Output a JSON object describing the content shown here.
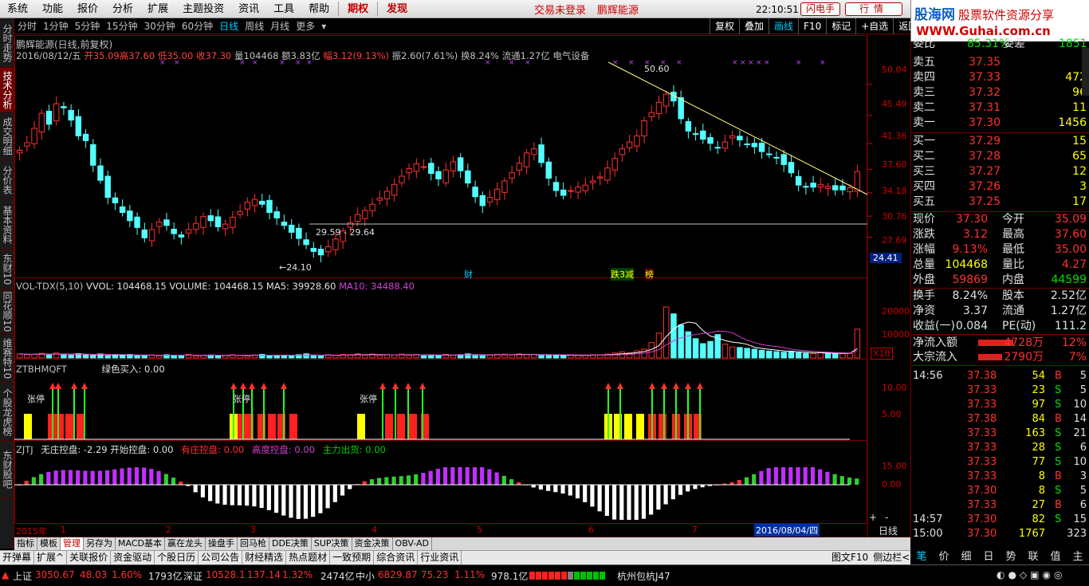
{
  "menu": {
    "items": [
      "系统",
      "功能",
      "报价",
      "分析",
      "扩展",
      "主题投资",
      "资讯",
      "工具",
      "帮助"
    ],
    "red_items": [
      "期权",
      "发现"
    ],
    "notice": "交易未登录",
    "stock_name": "鹏辉能源",
    "clock": "22:10:51 周五",
    "flash_trade": "闪电手",
    "quote_btn": "行情",
    "logo_line1": "股海网",
    "logo_line1b": "股票软件资源分享",
    "logo_line2": "WWW.Guhai.com.cn"
  },
  "periods": [
    "分时",
    "1分钟",
    "5分钟",
    "15分钟",
    "30分钟",
    "60分钟",
    "日线",
    "周线",
    "月线",
    "更多"
  ],
  "active_period": "日线",
  "chart_buttons": [
    "复权",
    "叠加",
    "画线",
    "F10",
    "标记",
    "+自选",
    "返回"
  ],
  "left_tabs": [
    "分时走势",
    "技术分析",
    "成交明细",
    "分价表",
    "基本资料",
    "东财10",
    "同花顺10",
    "维赛特10",
    "个股龙虎榜",
    "东财股吧"
  ],
  "header": {
    "title": "鹏辉能源(日线,前复权)",
    "date": "2016/08/12/五",
    "open": "开35.09",
    "high": "高37.60",
    "low": "低35.00",
    "close": "收37.30",
    "vol": "量104468",
    "amount": "额3.83亿",
    "change": "幅3.12(9.13%)",
    "amp": "振2.60(7.61%)",
    "turnover": "换8.24%",
    "float": "流通1.27亿",
    "sector": "电气设备"
  },
  "price_axis": [
    "50.04",
    "45.49",
    "41.36",
    "37.60",
    "34.18",
    "30.76",
    "27.69"
  ],
  "current_price_tag": "24.41",
  "annotations": {
    "peak": "50.60",
    "trough": "24.10",
    "range": "29.59 - 29.64",
    "cai": "财",
    "jian": "跌3减",
    "bang": "榜"
  },
  "vol_panel": {
    "label": "VOL-TDX(5,10)",
    "vvol": "VVOL: 104468.15",
    "volume": "VOLUME: 104468.15",
    "ma5": "MA5: 39928.60",
    "ma10": "MA10: 34488.40",
    "axis": [
      "20000",
      "10000"
    ],
    "unit": "X10"
  },
  "signal_panel": {
    "label": "ZTBHMQFT",
    "buy": "绿色买入: 0.00",
    "axis": [
      "10.00",
      "5.00"
    ],
    "tags": [
      "张停",
      "张停",
      "张停"
    ]
  },
  "ztj_panel": {
    "label": "ZJTJ",
    "a": "无庄控盘: -2.29",
    "b": "开始控盘: 0.00",
    "c": "有庄控盘: 0.00",
    "d": "高度控盘: 0.00",
    "e": "主力出货: 0.00",
    "axis": [
      "15.00",
      "0.00"
    ]
  },
  "x_axis": {
    "labels": [
      "2015年",
      "1",
      "2",
      "3",
      "4",
      "5",
      "6",
      "7"
    ],
    "cursor_date": "2016/08/04/四",
    "period": "日线"
  },
  "order_book": {
    "top": {
      "l": "委比",
      "v": "85.31%",
      "l2": "委差",
      "v2": "1851"
    },
    "asks": [
      {
        "label": "卖五",
        "price": "37.35",
        "vol": ""
      },
      {
        "label": "卖四",
        "price": "37.33",
        "vol": "472"
      },
      {
        "label": "卖三",
        "price": "37.32",
        "vol": "96"
      },
      {
        "label": "卖二",
        "price": "37.31",
        "vol": "11"
      },
      {
        "label": "卖一",
        "price": "37.30",
        "vol": "1456"
      }
    ],
    "bids": [
      {
        "label": "买一",
        "price": "37.29",
        "vol": "15"
      },
      {
        "label": "买二",
        "price": "37.28",
        "vol": "65"
      },
      {
        "label": "买三",
        "price": "37.27",
        "vol": "12"
      },
      {
        "label": "买四",
        "price": "37.26",
        "vol": "3"
      },
      {
        "label": "买五",
        "price": "37.25",
        "vol": "17"
      }
    ]
  },
  "stats": [
    {
      "l1": "现价",
      "v1": "37.30",
      "l2": "今开",
      "v2": "35.09",
      "c1": "r",
      "c2": "r"
    },
    {
      "l1": "涨跌",
      "v1": "3.12",
      "l2": "最高",
      "v2": "37.60",
      "c1": "r",
      "c2": "r"
    },
    {
      "l1": "涨幅",
      "v1": "9.13%",
      "l2": "最低",
      "v2": "35.00",
      "c1": "r",
      "c2": "r"
    },
    {
      "l1": "总量",
      "v1": "104468",
      "l2": "量比",
      "v2": "4.27",
      "c1": "y",
      "c2": "r"
    },
    {
      "l1": "外盘",
      "v1": "59869",
      "l2": "内盘",
      "v2": "44599",
      "c1": "r",
      "c2": "g"
    }
  ],
  "stats2": [
    {
      "l1": "换手",
      "v1": "8.24%",
      "l2": "股本",
      "v2": "2.52亿"
    },
    {
      "l1": "净资",
      "v1": "3.37",
      "l2": "流通",
      "v2": "1.27亿"
    },
    {
      "l1": "收益(一)",
      "v1": "0.084",
      "l2": "PE(动)",
      "v2": "111.2"
    }
  ],
  "flow": [
    {
      "l": "净流入额",
      "v": "4728万",
      "p": "12%"
    },
    {
      "l": "大宗流入",
      "v": "2790万",
      "p": "7%"
    }
  ],
  "ticks": [
    {
      "t": "14:56",
      "p": "37.38",
      "v": "54",
      "bs": "B",
      "n": "5"
    },
    {
      "t": "",
      "p": "37.33",
      "v": "23",
      "bs": "S",
      "n": "5"
    },
    {
      "t": "",
      "p": "37.33",
      "v": "97",
      "bs": "S",
      "n": "10"
    },
    {
      "t": "",
      "p": "37.38",
      "v": "84",
      "bs": "B",
      "n": "14"
    },
    {
      "t": "",
      "p": "37.33",
      "v": "163",
      "bs": "S",
      "n": "21"
    },
    {
      "t": "",
      "p": "37.33",
      "v": "28",
      "bs": "S",
      "n": "6"
    },
    {
      "t": "",
      "p": "37.33",
      "v": "77",
      "bs": "S",
      "n": "10"
    },
    {
      "t": "",
      "p": "37.33",
      "v": "8",
      "bs": "B",
      "n": "3"
    },
    {
      "t": "",
      "p": "37.30",
      "v": "8",
      "bs": "S",
      "n": "5"
    },
    {
      "t": "",
      "p": "37.33",
      "v": "27",
      "bs": "B",
      "n": "6"
    },
    {
      "t": "14:57",
      "p": "37.30",
      "v": "82",
      "bs": "S",
      "n": "15"
    },
    {
      "t": "15:00",
      "p": "37.30",
      "v": "1767",
      "bs": "",
      "n": "323"
    }
  ],
  "bottom_tabs1": [
    "指标",
    "模板",
    "管理",
    "另存为",
    "MACD基本",
    "赢在龙头",
    "操盘手",
    "回马枪",
    "DDE决策",
    "SUP决策",
    "资金决策",
    "OBV-AD"
  ],
  "bottom_tabs2": [
    "开弹幕",
    "扩展^",
    "关联报价",
    "资金驱动",
    "个股日历",
    "公司公告",
    "财经精选",
    "热点题材",
    "一致预期",
    "综合资讯",
    "行业资讯"
  ],
  "bottom_right": [
    "图文F10",
    "侧边栏<"
  ],
  "side_buttons": [
    "笔",
    "价",
    "细",
    "日",
    "势",
    "联",
    "值",
    "主"
  ],
  "status": {
    "sh_l": "上证",
    "sh_v": "3050.67",
    "sh_c": "48.03",
    "sh_p": "1.60%",
    "sh_a": "1793亿",
    "sz_l": "深证",
    "sz_v": "10528.1",
    "sz_c": "137.14",
    "sz_p": "1.32%",
    "sz_a": "2474亿",
    "zx_l": "中小",
    "zx_v": "6829.87",
    "zx_c": "75.23",
    "zx_p": "1.11%",
    "zx_a": "978.1亿",
    "loc": "杭州包杭J47"
  },
  "chart_data": {
    "type": "candlestick",
    "price_ylim": [
      22.5,
      53.5
    ],
    "ticks_y": [
      50.04,
      45.49,
      41.36,
      37.6,
      34.18,
      30.76,
      27.69
    ],
    "series": [
      {
        "name": "price",
        "values": [
          40.4,
          41.5,
          43.6,
          45.8,
          44.2,
          47.2,
          46.6,
          44.8,
          42.5,
          41.8,
          38.2,
          36.0,
          33.5,
          32.7,
          31.3,
          30.1,
          29.1,
          27.6,
          28.8,
          29.9,
          29.4,
          28.2,
          27.7,
          28.8,
          29.7,
          30.7,
          30.1,
          29.2,
          29.6,
          30.6,
          31.4,
          32.8,
          33.2,
          32.5,
          31.3,
          30.5,
          29.4,
          28.4,
          27.5,
          26.6,
          25.6,
          25.1,
          26.3,
          27.4,
          28.6,
          29.8,
          31.0,
          31.6,
          32.5,
          33.4,
          34.4,
          35.4,
          36.6,
          37.7,
          38.4,
          38.0,
          37.0,
          36.2,
          37.5,
          38.7,
          37.4,
          35.6,
          33.6,
          32.3,
          33.5,
          34.7,
          35.9,
          37.1,
          38.5,
          40.0,
          40.6,
          38.6,
          36.3,
          34.5,
          33.8,
          34.5,
          35.0,
          35.3,
          35.9,
          36.5,
          37.8,
          39.2,
          40.6,
          41.6,
          42.5,
          44.7,
          45.9,
          47.4,
          48.6,
          47.6,
          45.0,
          43.2,
          42.7,
          42.0,
          41.4,
          40.8,
          41.6,
          42.5,
          41.9,
          41.2,
          40.9,
          40.2,
          39.8,
          39.3,
          38.3,
          37.1,
          35.3,
          35.0,
          35.0,
          35.4,
          35.1,
          34.6,
          34.6,
          34.9,
          37.3
        ]
      },
      {
        "name": "volume",
        "values": [
          1500,
          1200,
          1300,
          1700,
          1100,
          1800,
          1400,
          1000,
          1600,
          1100,
          900,
          1500,
          800,
          1200,
          900,
          1300,
          700,
          1000,
          1100,
          800,
          1200,
          900,
          1000,
          1300,
          700,
          900,
          1100,
          800,
          1000,
          1200,
          900,
          700,
          1100,
          1300,
          800,
          900,
          1000,
          700,
          1200,
          1500,
          900,
          700,
          1100,
          900,
          1300,
          1200,
          1500,
          1000,
          1400,
          900,
          1200,
          1100,
          1400,
          1000,
          1300,
          800,
          1100,
          900,
          1300,
          1000,
          1200,
          1500,
          900,
          1100,
          1000,
          1300,
          1400,
          1100,
          1500,
          1200,
          1300,
          900,
          1100,
          1000,
          800,
          1100,
          900,
          1000,
          1200,
          1100,
          1400,
          1800,
          2200,
          1900,
          2600,
          3200,
          5600,
          9000,
          18500,
          16000,
          12000,
          9500,
          7000,
          5200,
          6000,
          8500,
          5000,
          4000,
          3800,
          3500,
          3200,
          2800,
          2500,
          2300,
          2100,
          2400,
          1900,
          1700,
          1600,
          2000,
          1800,
          1500,
          1600,
          1700,
          10446
        ]
      }
    ]
  }
}
